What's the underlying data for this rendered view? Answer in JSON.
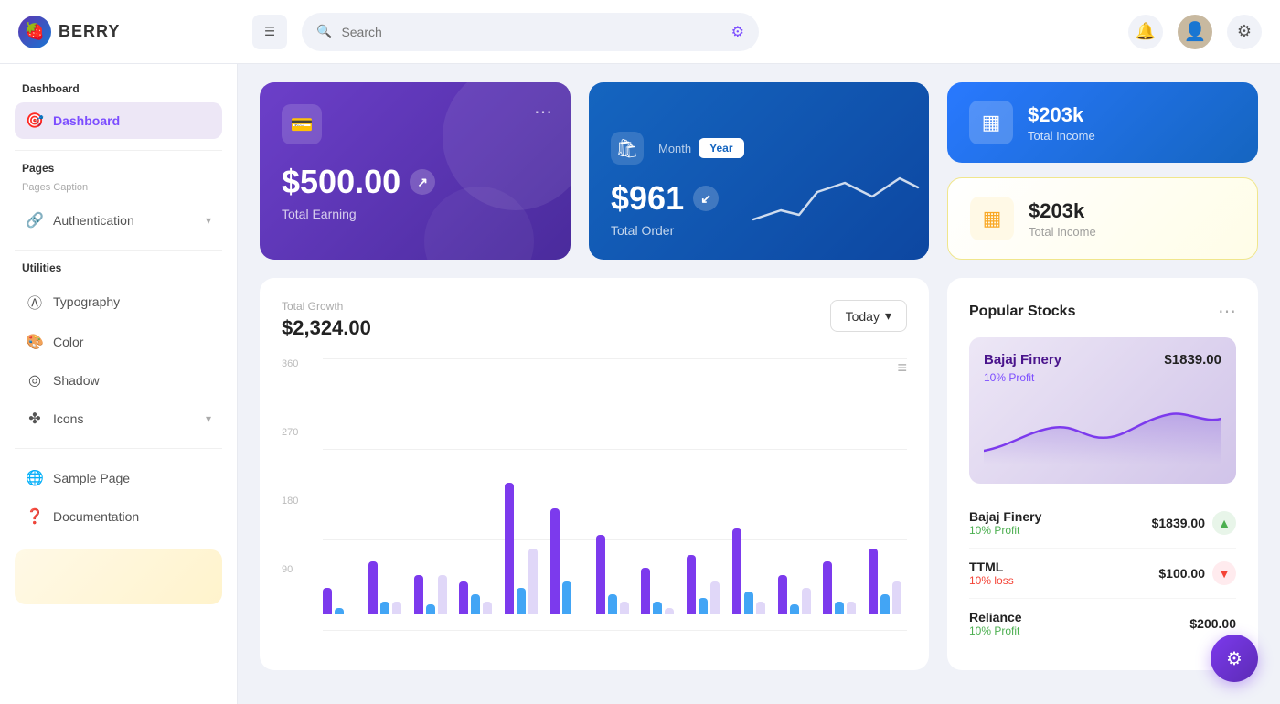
{
  "header": {
    "logo_text": "BERRY",
    "search_placeholder": "Search",
    "menu_icon": "☰",
    "filter_icon": "⚙",
    "notif_icon": "🔔",
    "gear_icon": "⚙",
    "avatar_emoji": "👤"
  },
  "sidebar": {
    "section_dashboard": "Dashboard",
    "item_dashboard": "Dashboard",
    "section_pages": "Pages",
    "pages_caption": "Pages Caption",
    "item_authentication": "Authentication",
    "section_utilities": "Utilities",
    "item_typography": "Typography",
    "item_color": "Color",
    "item_shadow": "Shadow",
    "item_icons": "Icons",
    "item_sample_page": "Sample Page",
    "item_documentation": "Documentation"
  },
  "cards": {
    "earning_amount": "$500.00",
    "earning_label": "Total Earning",
    "order_amount": "$961",
    "order_label": "Total Order",
    "order_tab_month": "Month",
    "order_tab_year": "Year",
    "income_blue_amount": "$203k",
    "income_blue_label": "Total Income",
    "income_yellow_amount": "$203k",
    "income_yellow_label": "Total Income"
  },
  "chart": {
    "title": "Total Growth",
    "amount": "$2,324.00",
    "today_btn": "Today",
    "y_labels": [
      "360",
      "270",
      "180",
      "90"
    ],
    "bars": [
      {
        "purple": 40,
        "lb": 10,
        "lavender": 0
      },
      {
        "purple": 80,
        "lb": 20,
        "lavender": 20
      },
      {
        "purple": 60,
        "lb": 15,
        "lavender": 60
      },
      {
        "purple": 50,
        "lb": 30,
        "lavender": 20
      },
      {
        "purple": 200,
        "lb": 40,
        "lavender": 100
      },
      {
        "purple": 160,
        "lb": 50,
        "lavender": 0
      },
      {
        "purple": 120,
        "lb": 30,
        "lavender": 20
      },
      {
        "purple": 70,
        "lb": 20,
        "lavender": 10
      },
      {
        "purple": 90,
        "lb": 25,
        "lavender": 50
      },
      {
        "purple": 130,
        "lb": 35,
        "lavender": 20
      },
      {
        "purple": 60,
        "lb": 15,
        "lavender": 40
      },
      {
        "purple": 80,
        "lb": 20,
        "lavender": 20
      },
      {
        "purple": 100,
        "lb": 30,
        "lavender": 50
      }
    ]
  },
  "stocks": {
    "title": "Popular Stocks",
    "featured_name": "Bajaj Finery",
    "featured_price": "$1839.00",
    "featured_profit": "10% Profit",
    "list": [
      {
        "name": "Bajaj Finery",
        "profit": "10% Profit",
        "profit_type": "up",
        "price": "$1839.00"
      },
      {
        "name": "TTML",
        "profit": "10% loss",
        "profit_type": "down",
        "price": "$100.00"
      },
      {
        "name": "Reliance",
        "profit": "10% Profit",
        "profit_type": "up",
        "price": "$200.00"
      }
    ]
  },
  "fab": {
    "icon": "⚙"
  }
}
